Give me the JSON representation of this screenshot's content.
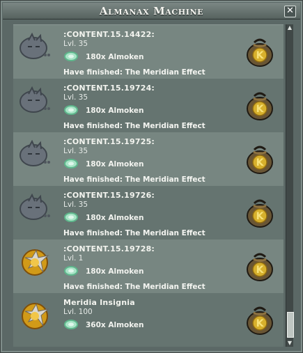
{
  "window": {
    "title": "Almanax Machine",
    "close_label": "✕"
  },
  "rows": [
    {
      "name": ":CONTENT.15.14422:",
      "level": "Lvl. 35",
      "reward": "180x Almoken",
      "status": "Have finished: The Meridian Effect",
      "icon": "grey-creature-icon"
    },
    {
      "name": ":CONTENT.15.19724:",
      "level": "Lvl. 35",
      "reward": "180x Almoken",
      "status": "Have finished: The Meridian Effect",
      "icon": "grey-creature-icon"
    },
    {
      "name": ":CONTENT.15.19725:",
      "level": "Lvl. 35",
      "reward": "180x Almoken",
      "status": "Have finished: The Meridian Effect",
      "icon": "grey-creature-icon"
    },
    {
      "name": ":CONTENT.15.19726:",
      "level": "Lvl. 35",
      "reward": "180x Almoken",
      "status": "Have finished: The Meridian Effect",
      "icon": "grey-creature-icon"
    },
    {
      "name": ":CONTENT.15.19728:",
      "level": "Lvl. 1",
      "reward": "180x Almoken",
      "status": "Have finished: The Meridian Effect",
      "icon": "meridia-insignia-icon"
    },
    {
      "name": "Meridia Insignia",
      "level": "Lvl. 100",
      "reward": "360x Almoken",
      "status": "",
      "icon": "meridia-insignia-icon"
    }
  ],
  "icons": {
    "reward_bag": "kama-bag-icon",
    "currency": "almoken-coin-icon"
  },
  "colors": {
    "row_light": "#778681",
    "row_dark": "#657470",
    "window": "#5b6866",
    "bag_gold": "#d6ad2b",
    "coin_green": "#91d8b4"
  }
}
